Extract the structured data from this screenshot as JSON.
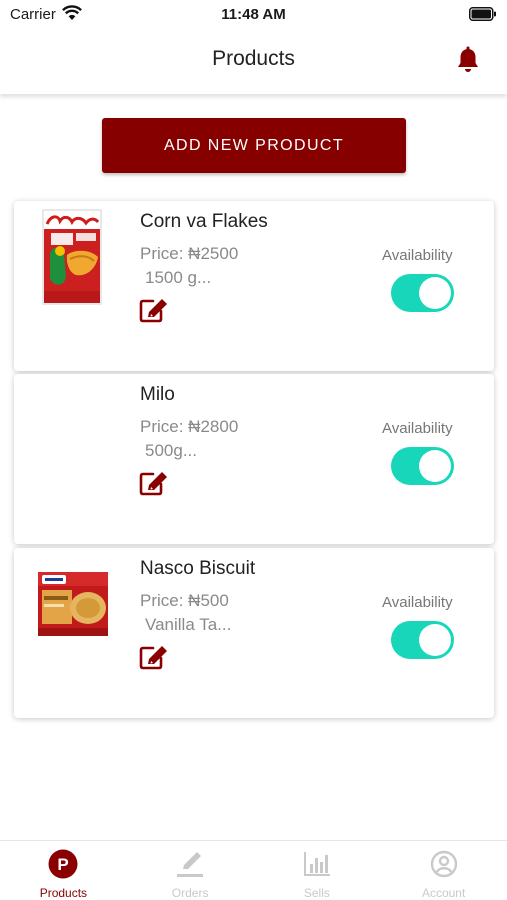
{
  "status_bar": {
    "carrier": "Carrier",
    "time": "11:48 AM"
  },
  "header": {
    "title": "Products",
    "icon": "bell-icon"
  },
  "add_button": {
    "label": "ADD NEW PRODUCT"
  },
  "products": [
    {
      "name": "Corn va Flakes",
      "price": "Price: ₦2500",
      "description": "1500 g...",
      "availability_label": "Availability",
      "available": true,
      "image": "corn-flakes-box"
    },
    {
      "name": "Milo",
      "price": "Price: ₦2800",
      "description": "500g...",
      "availability_label": "Availability",
      "available": true,
      "image": "none"
    },
    {
      "name": "Nasco Biscuit",
      "price": "Price: ₦500",
      "description": "Vanilla Ta...",
      "availability_label": "Availability",
      "available": true,
      "image": "nasco-biscuit-pack"
    }
  ],
  "tabs": [
    {
      "label": "Products",
      "icon": "products-p-icon",
      "active": true
    },
    {
      "label": "Orders",
      "icon": "pencil-icon",
      "active": false
    },
    {
      "label": "Sells",
      "icon": "bar-chart-icon",
      "active": false
    },
    {
      "label": "Account",
      "icon": "account-icon",
      "active": false
    }
  ],
  "colors": {
    "primary": "#870000",
    "toggle_on": "#17d6b9",
    "muted_text": "#8a8a8a",
    "tab_inactive": "#c9c9c9"
  }
}
